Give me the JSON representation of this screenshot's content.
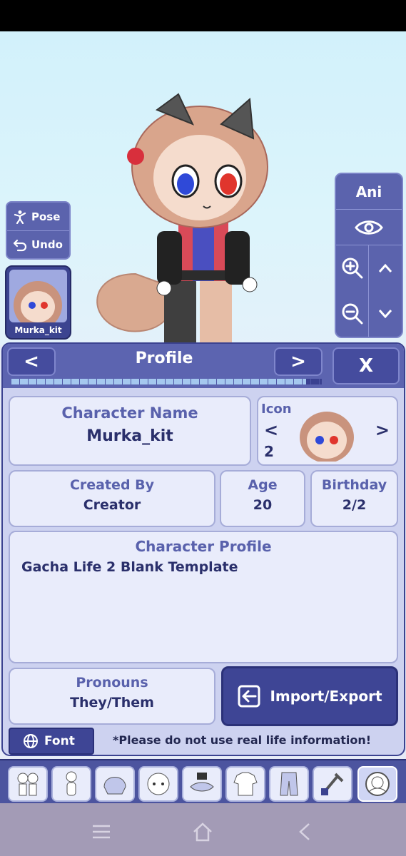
{
  "scene": {
    "pose_label": "Pose",
    "undo_label": "Undo",
    "character_name": "Murka_kit",
    "ani_label": "Ani"
  },
  "panel": {
    "title": "Profile",
    "prev_label": "<",
    "next_label": ">",
    "close_label": "X",
    "progress_fraction": 0.95,
    "character_name_label": "Character Name",
    "character_name_value": "Murka_kit",
    "icon_label": "Icon",
    "icon_prev": "<",
    "icon_next": ">",
    "icon_number": "2",
    "created_by_label": "Created By",
    "created_by_value": "Creator",
    "age_label": "Age",
    "age_value": "20",
    "birthday_label": "Birthday",
    "birthday_value": "2/2",
    "profile_label": "Character Profile",
    "profile_text": "Gacha Life 2 Blank Template",
    "pronouns_label": "Pronouns",
    "pronouns_value": "They/Them",
    "import_export_label": "Import/Export",
    "font_label": "Font",
    "notice": "*Please do not use real life information!"
  },
  "categories": [
    "preset-icon",
    "body-icon",
    "hair-icon",
    "face-icon",
    "accessory-icon",
    "top-icon",
    "bottom-icon",
    "props-icon",
    "profile-icon"
  ],
  "active_category": "profile-icon",
  "colors": {
    "accent": "#5c64b0",
    "panel_bg": "#cdd2f0",
    "card_bg": "#e9ecfb",
    "label_text": "#5961ac",
    "value_text": "#2a2f6b"
  }
}
